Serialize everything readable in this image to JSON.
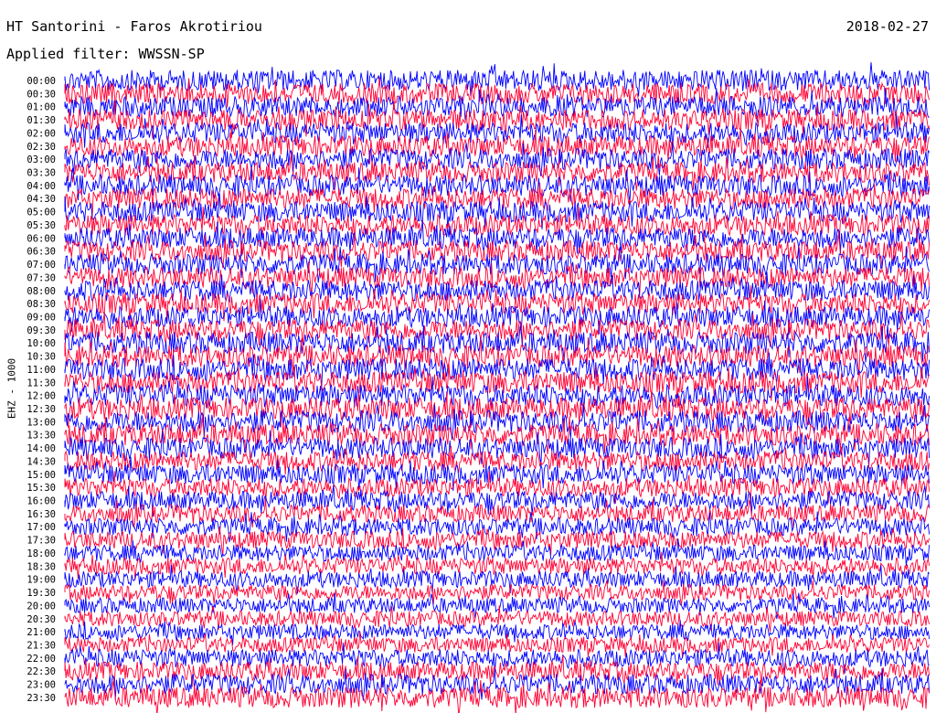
{
  "header": {
    "title": "HT Santorini - Faros Akrotiriou",
    "date": "2018-02-27",
    "filter": "Applied filter: WWSSN-SP"
  },
  "chart_data": {
    "type": "line",
    "title": "HT Santorini - Faros Akrotiriou",
    "ylabel": "EHZ - 1000",
    "row_labels": [
      "00:00",
      "00:30",
      "01:00",
      "01:30",
      "02:00",
      "02:30",
      "03:00",
      "03:30",
      "04:00",
      "04:30",
      "05:00",
      "05:30",
      "06:00",
      "06:30",
      "07:00",
      "07:30",
      "08:00",
      "08:30",
      "09:00",
      "09:30",
      "10:00",
      "10:30",
      "11:00",
      "11:30",
      "12:00",
      "12:30",
      "13:00",
      "13:30",
      "14:00",
      "14:30",
      "15:00",
      "15:30",
      "16:00",
      "16:30",
      "17:00",
      "17:30",
      "18:00",
      "18:30",
      "19:00",
      "19:30",
      "20:00",
      "20:30",
      "21:00",
      "21:30",
      "22:00",
      "22:30",
      "23:00",
      "23:30"
    ],
    "trace_colors": [
      "#0000ff",
      "#ff0033"
    ],
    "amplitude_profile": [
      0.95,
      0.95,
      0.95,
      0.95,
      0.95,
      0.95,
      0.95,
      0.95,
      0.95,
      0.95,
      0.95,
      0.95,
      0.95,
      0.95,
      0.95,
      0.95,
      0.95,
      0.95,
      0.95,
      0.95,
      1.0,
      1.0,
      1.0,
      1.0,
      1.0,
      1.0,
      1.0,
      1.0,
      0.95,
      0.9,
      0.9,
      0.85,
      0.85,
      0.8,
      0.8,
      0.8,
      0.75,
      0.75,
      0.75,
      0.7,
      0.7,
      0.7,
      0.7,
      0.7,
      0.8,
      0.85,
      0.9,
      0.95
    ],
    "events": [
      {
        "row": "09:00",
        "label": ""
      }
    ]
  }
}
